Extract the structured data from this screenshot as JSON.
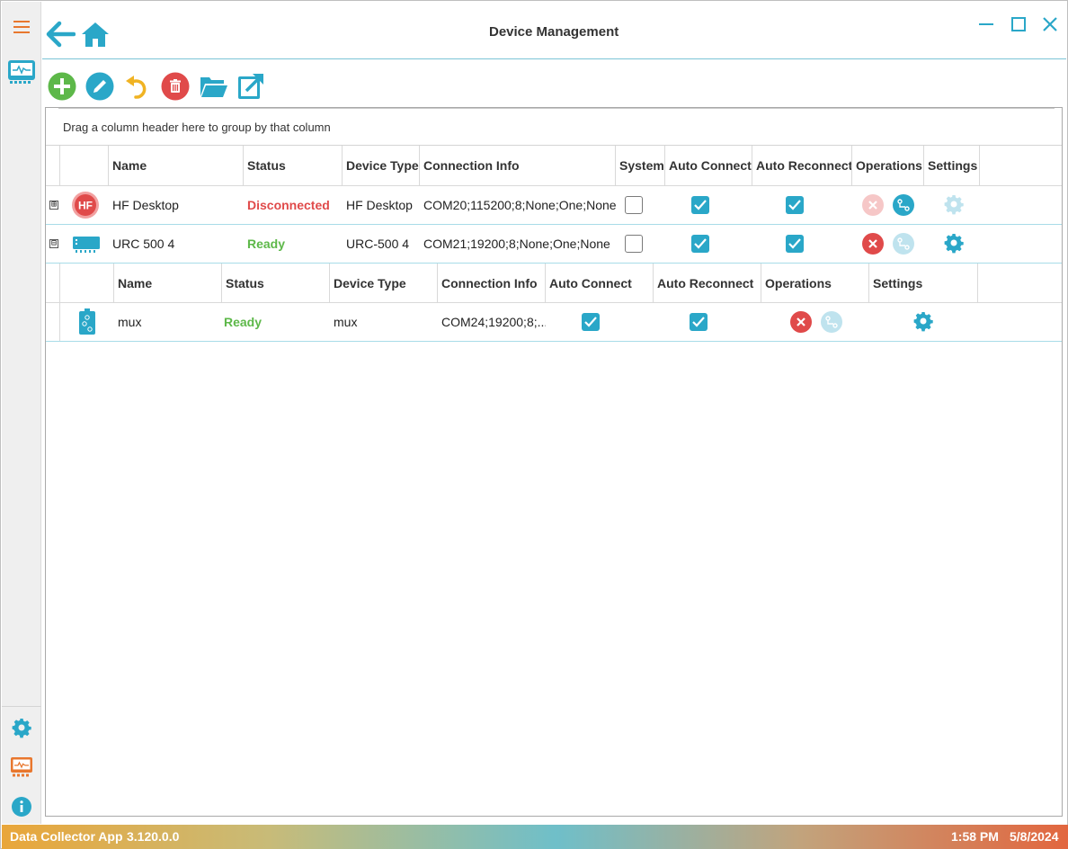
{
  "window": {
    "title": "Device Management"
  },
  "rail": {
    "menu_icon": "hamburger-menu-icon",
    "top_items": [
      {
        "icon": "monitor-device-icon",
        "color": "#2aa7c8"
      }
    ],
    "bottom_items": [
      {
        "icon": "gear-icon",
        "color": "#2aa7c8"
      },
      {
        "icon": "monitor-device-icon",
        "color": "#e8772e"
      },
      {
        "icon": "info-icon",
        "color": "#2aa7c8"
      }
    ]
  },
  "toolbar": {
    "buttons": [
      {
        "icon": "add-icon",
        "color": "#5db849"
      },
      {
        "icon": "edit-icon",
        "color": "#2aa7c8"
      },
      {
        "icon": "undo-icon",
        "color": "#f0b323"
      },
      {
        "icon": "delete-icon",
        "color": "#e04a4a"
      },
      {
        "icon": "folder-open-icon",
        "color": "#2aa7c8"
      },
      {
        "icon": "export-icon",
        "color": "#2aa7c8"
      }
    ]
  },
  "grid": {
    "group_hint": "Drag a column header here to group by that column",
    "columns": [
      "Name",
      "Status",
      "Device Type",
      "Connection Info",
      "System",
      "Auto Connect",
      "Auto Reconnect",
      "Operations",
      "Settings"
    ],
    "rows": [
      {
        "expander": "⊞",
        "icon": "hf-desktop-icon",
        "icon_text": "HF",
        "name": "HF Desktop",
        "status": "Disconnected",
        "device_type": "HF Desktop",
        "connection_info": "COM20;115200;8;None;One;None",
        "system": false,
        "auto_connect": true,
        "auto_reconnect": true
      },
      {
        "expander": "⊟",
        "icon": "urc-device-icon",
        "name": "URC 500 4",
        "status": "Ready",
        "device_type": "URC-500 4",
        "connection_info": "COM21;19200;8;None;One;None",
        "system": false,
        "auto_connect": true,
        "auto_reconnect": true
      }
    ],
    "child_columns": [
      "Name",
      "Status",
      "Device Type",
      "Connection Info",
      "Auto Connect",
      "Auto Reconnect",
      "Operations",
      "Settings"
    ],
    "child_rows": [
      {
        "icon": "mux-device-icon",
        "name": "mux",
        "status": "Ready",
        "device_type": "mux",
        "connection_info": "COM24;19200;8;...",
        "auto_connect": true,
        "auto_reconnect": true
      }
    ]
  },
  "statusbar": {
    "app_name": "Data Collector App",
    "version": "3.120.0.0",
    "time": "1:58 PM",
    "date": "5/8/2024"
  },
  "colors": {
    "accent": "#2aa7c8",
    "disconnected": "#e04a4a",
    "ready": "#5db849",
    "disabled": "#bfe3ee"
  }
}
